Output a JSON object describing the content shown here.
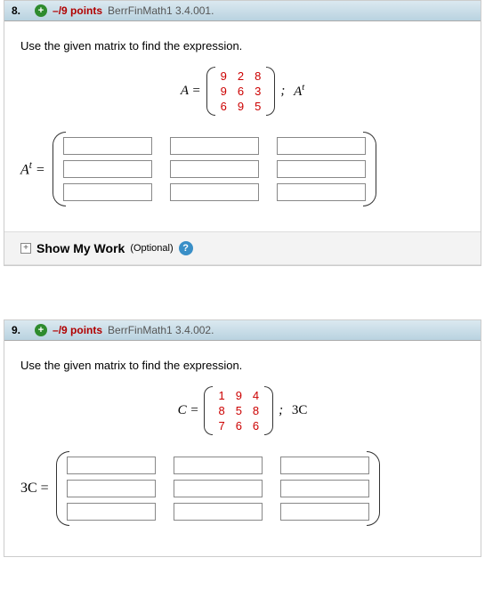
{
  "questions": [
    {
      "number": "8.",
      "points": "–/9 points",
      "assignment": "BerrFinMath1 3.4.001.",
      "prompt": "Use the given matrix to find the expression.",
      "matrix_var": "A =",
      "matrix": [
        [
          "9",
          "2",
          "8"
        ],
        [
          "9",
          "6",
          "3"
        ],
        [
          "6",
          "9",
          "5"
        ]
      ],
      "target_expr_html": "A<sup>t</sup>",
      "answer_label_html": "A<sup>t</sup> =",
      "show_work_label": "Show My Work",
      "show_work_optional": "(Optional)"
    },
    {
      "number": "9.",
      "points": "–/9 points",
      "assignment": "BerrFinMath1 3.4.002.",
      "prompt": "Use the given matrix to find the expression.",
      "matrix_var": "C =",
      "matrix": [
        [
          "1",
          "9",
          "4"
        ],
        [
          "8",
          "5",
          "8"
        ],
        [
          "7",
          "6",
          "6"
        ]
      ],
      "target_expr_html": "3C",
      "answer_label_html": "3C ="
    }
  ],
  "chart_data": {
    "type": "table",
    "description": "Two 3x3 matrices presented for transpose and scalar-multiplication exercises",
    "matrices": {
      "A": [
        [
          9,
          2,
          8
        ],
        [
          9,
          6,
          3
        ],
        [
          6,
          9,
          5
        ]
      ],
      "C": [
        [
          1,
          9,
          4
        ],
        [
          8,
          5,
          8
        ],
        [
          7,
          6,
          6
        ]
      ]
    },
    "operations": {
      "q8": "A^t",
      "q9": "3C"
    }
  }
}
